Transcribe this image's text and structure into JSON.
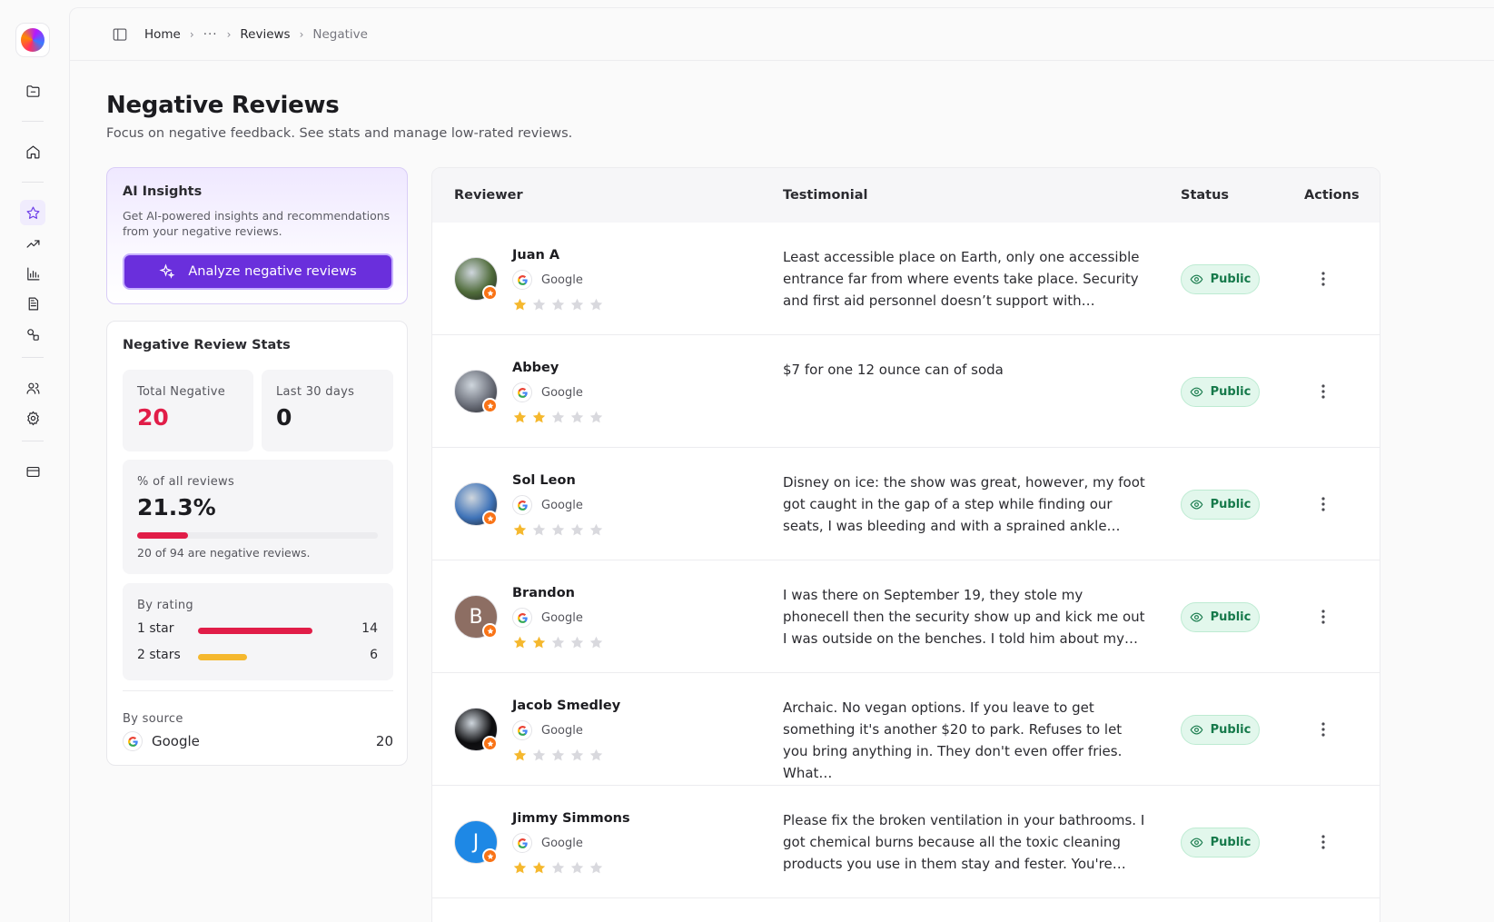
{
  "breadcrumb": {
    "home": "Home",
    "ellipsis": "···",
    "reviews": "Reviews",
    "current": "Negative"
  },
  "page": {
    "title": "Negative Reviews",
    "subtitle": "Focus on negative feedback. See stats and manage low-rated reviews."
  },
  "ai_insights": {
    "title": "AI Insights",
    "description": "Get AI-powered insights and recommendations from your negative reviews.",
    "button_label": "Analyze negative reviews"
  },
  "stats": {
    "title": "Negative Review Stats",
    "total_negative_label": "Total Negative",
    "total_negative_value": "20",
    "last30_label": "Last 30 days",
    "last30_value": "0",
    "pct_label": "% of all reviews",
    "pct_value": "21.3%",
    "pct_fraction": 0.213,
    "pct_note": "20 of 94 are negative reviews.",
    "by_rating_label": "By rating",
    "ratings": [
      {
        "label": "1 star",
        "count": "14",
        "fraction": 0.7,
        "color": "#e11d48"
      },
      {
        "label": "2 stars",
        "count": "6",
        "fraction": 0.3,
        "color": "#f5b82e"
      }
    ],
    "by_source_label": "By source",
    "sources": [
      {
        "label": "Google",
        "count": "20"
      }
    ]
  },
  "table": {
    "headers": {
      "reviewer": "Reviewer",
      "testimonial": "Testimonial",
      "status": "Status",
      "actions": "Actions"
    },
    "rows": [
      {
        "name": "Juan A",
        "source": "Google",
        "rating": 1,
        "text": "Least accessible place on Earth, only one accessible entrance far from where events take place. Security and first aid personnel doesn’t support with…",
        "status": "Public",
        "avatar": "photo",
        "avatar_color": "#4f6b3a",
        "avatar_letter": ""
      },
      {
        "name": "Abbey",
        "source": "Google",
        "rating": 2,
        "text": "$7 for one 12 ounce can of soda",
        "status": "Public",
        "avatar": "photo",
        "avatar_color": "#6b6f7a",
        "avatar_letter": ""
      },
      {
        "name": "Sol Leon",
        "source": "Google",
        "rating": 1,
        "text": "Disney on ice: the show was great, however, my foot got caught in the gap of a step while finding our seats, I was bleeding and with a sprained ankle…",
        "status": "Public",
        "avatar": "photo",
        "avatar_color": "#3f73b8",
        "avatar_letter": ""
      },
      {
        "name": "Brandon",
        "source": "Google",
        "rating": 2,
        "text": "I was there on September 19, they stole my phonecell then the security show up and kick me out I was outside on the benches. I told him about my…",
        "status": "Public",
        "avatar": "letter",
        "avatar_color": "#8d6e63",
        "avatar_letter": "B"
      },
      {
        "name": "Jacob Smedley",
        "source": "Google",
        "rating": 1,
        "text": "Archaic. No vegan options. If you leave to get something it's another $20 to park. Refuses to let you bring anything in. They don't even offer fries. What…",
        "status": "Public",
        "avatar": "photo",
        "avatar_color": "#0c0c0e",
        "avatar_letter": ""
      },
      {
        "name": "Jimmy Simmons",
        "source": "Google",
        "rating": 2,
        "text": "Please fix the broken ventilation in your bathrooms. I got chemical burns because all the toxic cleaning products you use in them stay and fester. You're…",
        "status": "Public",
        "avatar": "letter",
        "avatar_color": "#1e88e5",
        "avatar_letter": "J"
      }
    ]
  },
  "colors": {
    "accent": "#6a2fdc",
    "negative": "#e11d48",
    "star_filled": "#f5b82e",
    "star_empty": "#d9d9de",
    "public_bg": "#e2f7ec",
    "public_text": "#15794a"
  },
  "icons": {
    "rail": [
      "logo-icon",
      "folder-icon",
      "home-icon",
      "star-icon",
      "trending-icon",
      "bar-chart-icon",
      "document-icon",
      "integrations-icon",
      "users-icon",
      "settings-icon",
      "credit-card-icon"
    ]
  }
}
